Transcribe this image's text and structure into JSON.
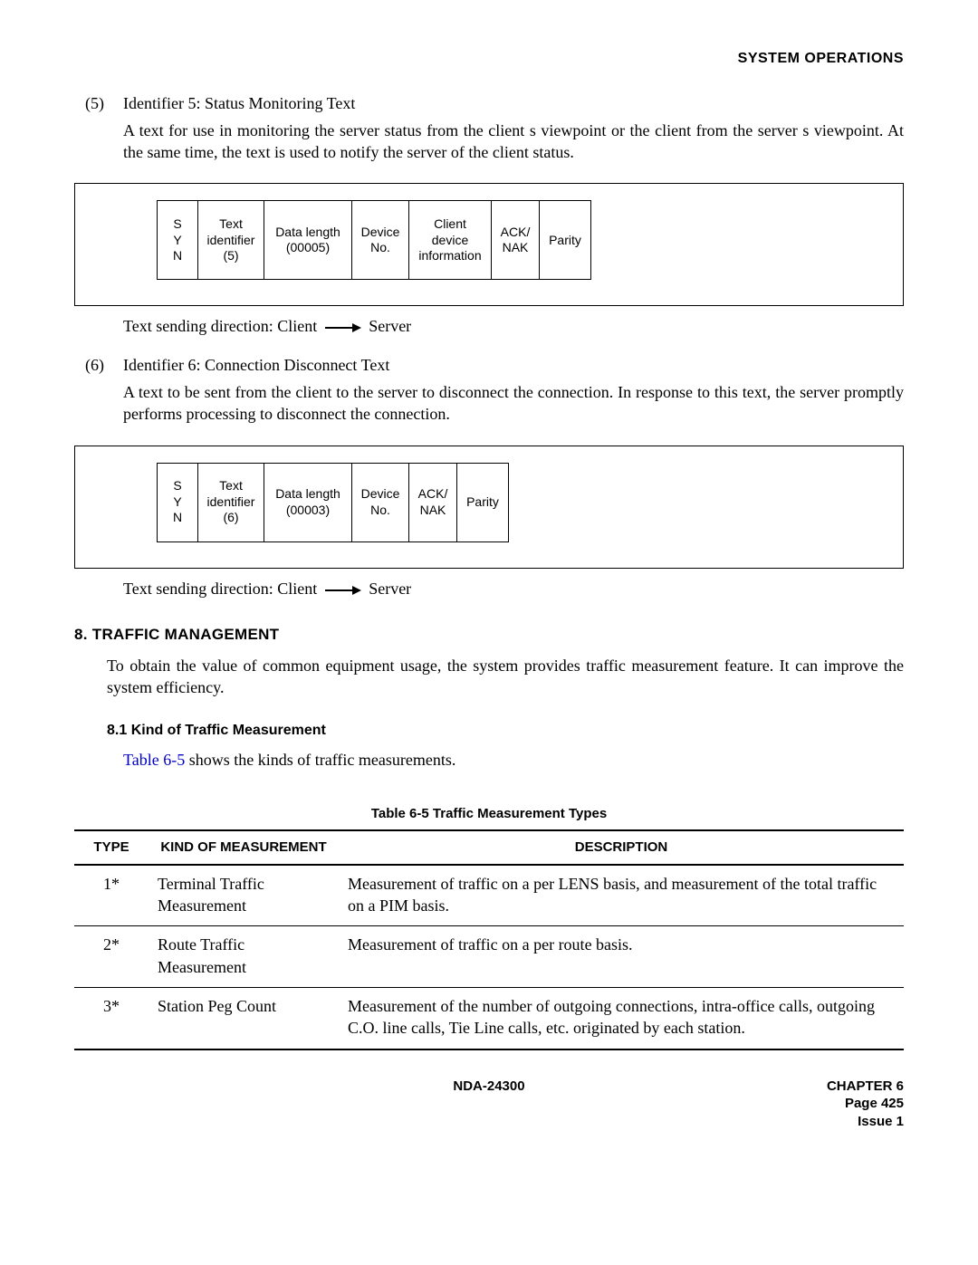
{
  "header": {
    "right": "SYSTEM OPERATIONS"
  },
  "item5": {
    "num": "(5)",
    "title": "Identifier 5: Status Monitoring Text",
    "body": "A text for use in monitoring the server status from the client s viewpoint or the client from the server s viewpoint. At the same time, the text is used to notify the server of the client status.",
    "packet": {
      "syn": "S\nY\nN",
      "ti": "Text\nidentifier\n(5)",
      "dlen": "Data length\n(00005)",
      "dev": "Device\nNo.",
      "cdi": "Client\ndevice\ninformation",
      "ack": "ACK/\nNAK",
      "parity": "Parity"
    },
    "dir_prefix": "Text sending direction: Client",
    "dir_suffix": "Server"
  },
  "item6": {
    "num": "(6)",
    "title": "Identifier 6: Connection Disconnect Text",
    "body": "A text to be sent from the client to the server to disconnect the connection. In response to this text, the server promptly performs processing to disconnect the connection.",
    "packet": {
      "syn": "S\nY\nN",
      "ti": "Text\nidentifier\n(6)",
      "dlen": "Data length\n(00003)",
      "dev": "Device\nNo.",
      "ack": "ACK/\nNAK",
      "parity": "Parity"
    },
    "dir_prefix": "Text sending direction: Client",
    "dir_suffix": "Server"
  },
  "section8": {
    "heading": "8.  TRAFFIC MANAGEMENT",
    "body": "To obtain the value of common equipment usage, the system provides traffic measurement feature. It can improve the system efficiency."
  },
  "section81": {
    "heading": "8.1  Kind of Traffic Measurement",
    "link": "Table 6-5",
    "body_rest": " shows the kinds of traffic measurements."
  },
  "table": {
    "caption": "Table 6-5  Traffic Measurement Types",
    "head": {
      "c1": "TYPE",
      "c2": "KIND OF MEASUREMENT",
      "c3": "DESCRIPTION"
    },
    "rows": [
      {
        "type": "1*",
        "kind": "Terminal Traffic Measurement",
        "desc": "Measurement of traffic on a per LENS basis, and measurement of the total traffic on a PIM basis."
      },
      {
        "type": "2*",
        "kind": "Route Traffic Measurement",
        "desc": "Measurement of traffic on a per route basis."
      },
      {
        "type": "3*",
        "kind": "Station Peg Count",
        "desc": "Measurement of the number of outgoing connections, intra-office calls, outgoing C.O. line calls, Tie Line calls, etc. originated by each station."
      }
    ]
  },
  "footer": {
    "center": "NDA-24300",
    "right1": "CHAPTER 6",
    "right2": "Page 425",
    "right3": "Issue 1"
  }
}
